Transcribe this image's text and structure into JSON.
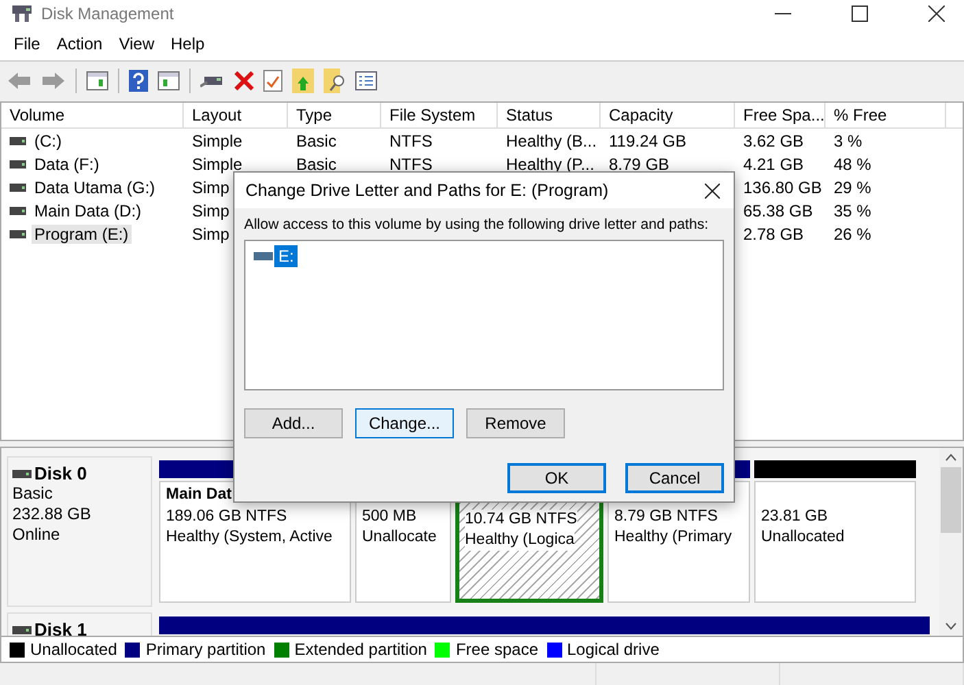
{
  "window": {
    "title": "Disk Management"
  },
  "menu": [
    "File",
    "Action",
    "View",
    "Help"
  ],
  "table": {
    "columns": [
      "Volume",
      "Layout",
      "Type",
      "File System",
      "Status",
      "Capacity",
      "Free Spa...",
      "% Free"
    ],
    "rows": [
      {
        "selected": false,
        "cells": [
          "(C:)",
          "Simple",
          "Basic",
          "NTFS",
          "Healthy (B...",
          "119.24 GB",
          "3.62 GB",
          "3 %"
        ]
      },
      {
        "selected": false,
        "cells": [
          "Data (F:)",
          "Simple",
          "Basic",
          "NTFS",
          "Healthy (P...",
          "8.79 GB",
          "4.21 GB",
          "48 %"
        ]
      },
      {
        "selected": false,
        "cells": [
          "Data Utama (G:)",
          "Simp",
          null,
          null,
          null,
          null,
          "136.80 GB",
          "29 %"
        ]
      },
      {
        "selected": false,
        "cells": [
          "Main Data (D:)",
          "Simp",
          null,
          null,
          null,
          null,
          "65.38 GB",
          "35 %"
        ]
      },
      {
        "selected": true,
        "cells": [
          "Program (E:)",
          "Simp",
          null,
          null,
          null,
          null,
          "2.78 GB",
          "26 %"
        ]
      }
    ]
  },
  "dialog": {
    "title": "Change Drive Letter and Paths for E: (Program)",
    "prompt": "Allow access to this volume by using the following drive letter and paths:",
    "paths": [
      {
        "label": "E:",
        "selected": true
      }
    ],
    "buttons": [
      {
        "label": "Add...",
        "kind": "normal"
      },
      {
        "label": "Change...",
        "kind": "focused"
      },
      {
        "label": "Remove",
        "kind": "normal"
      }
    ],
    "footer_buttons": [
      {
        "label": "OK",
        "kind": "default"
      },
      {
        "label": "Cancel",
        "kind": "default"
      }
    ]
  },
  "disks": [
    {
      "name": "Disk 0",
      "lines": [
        "Basic",
        "232.88 GB",
        "Online"
      ],
      "partitions": [
        {
          "kind": "primary",
          "selected": false,
          "name": "Main Dat",
          "size": "189.06 GB NTFS",
          "status": "Healthy (System, Active"
        },
        {
          "kind": "unallocated",
          "selected": false,
          "size": "500 MB",
          "status": "Unallocate"
        },
        {
          "kind": "logical",
          "selected": true,
          "size": "10.74 GB NTFS",
          "status": "Healthy (Logica"
        },
        {
          "kind": "primary",
          "selected": false,
          "size": "8.79 GB NTFS",
          "status": "Healthy (Primary"
        },
        {
          "kind": "unallocated",
          "selected": false,
          "size": "23.81 GB",
          "status": "Unallocated"
        }
      ]
    },
    {
      "name": "Disk 1",
      "partitions": [
        {
          "kind": "primary"
        }
      ]
    }
  ],
  "legend": [
    {
      "label": "Unallocated",
      "color": "#000000"
    },
    {
      "label": "Primary partition",
      "color": "#000080"
    },
    {
      "label": "Extended partition",
      "color": "#008000"
    },
    {
      "label": "Free space",
      "color": "#00ff00"
    },
    {
      "label": "Logical drive",
      "color": "#0000ff"
    }
  ]
}
